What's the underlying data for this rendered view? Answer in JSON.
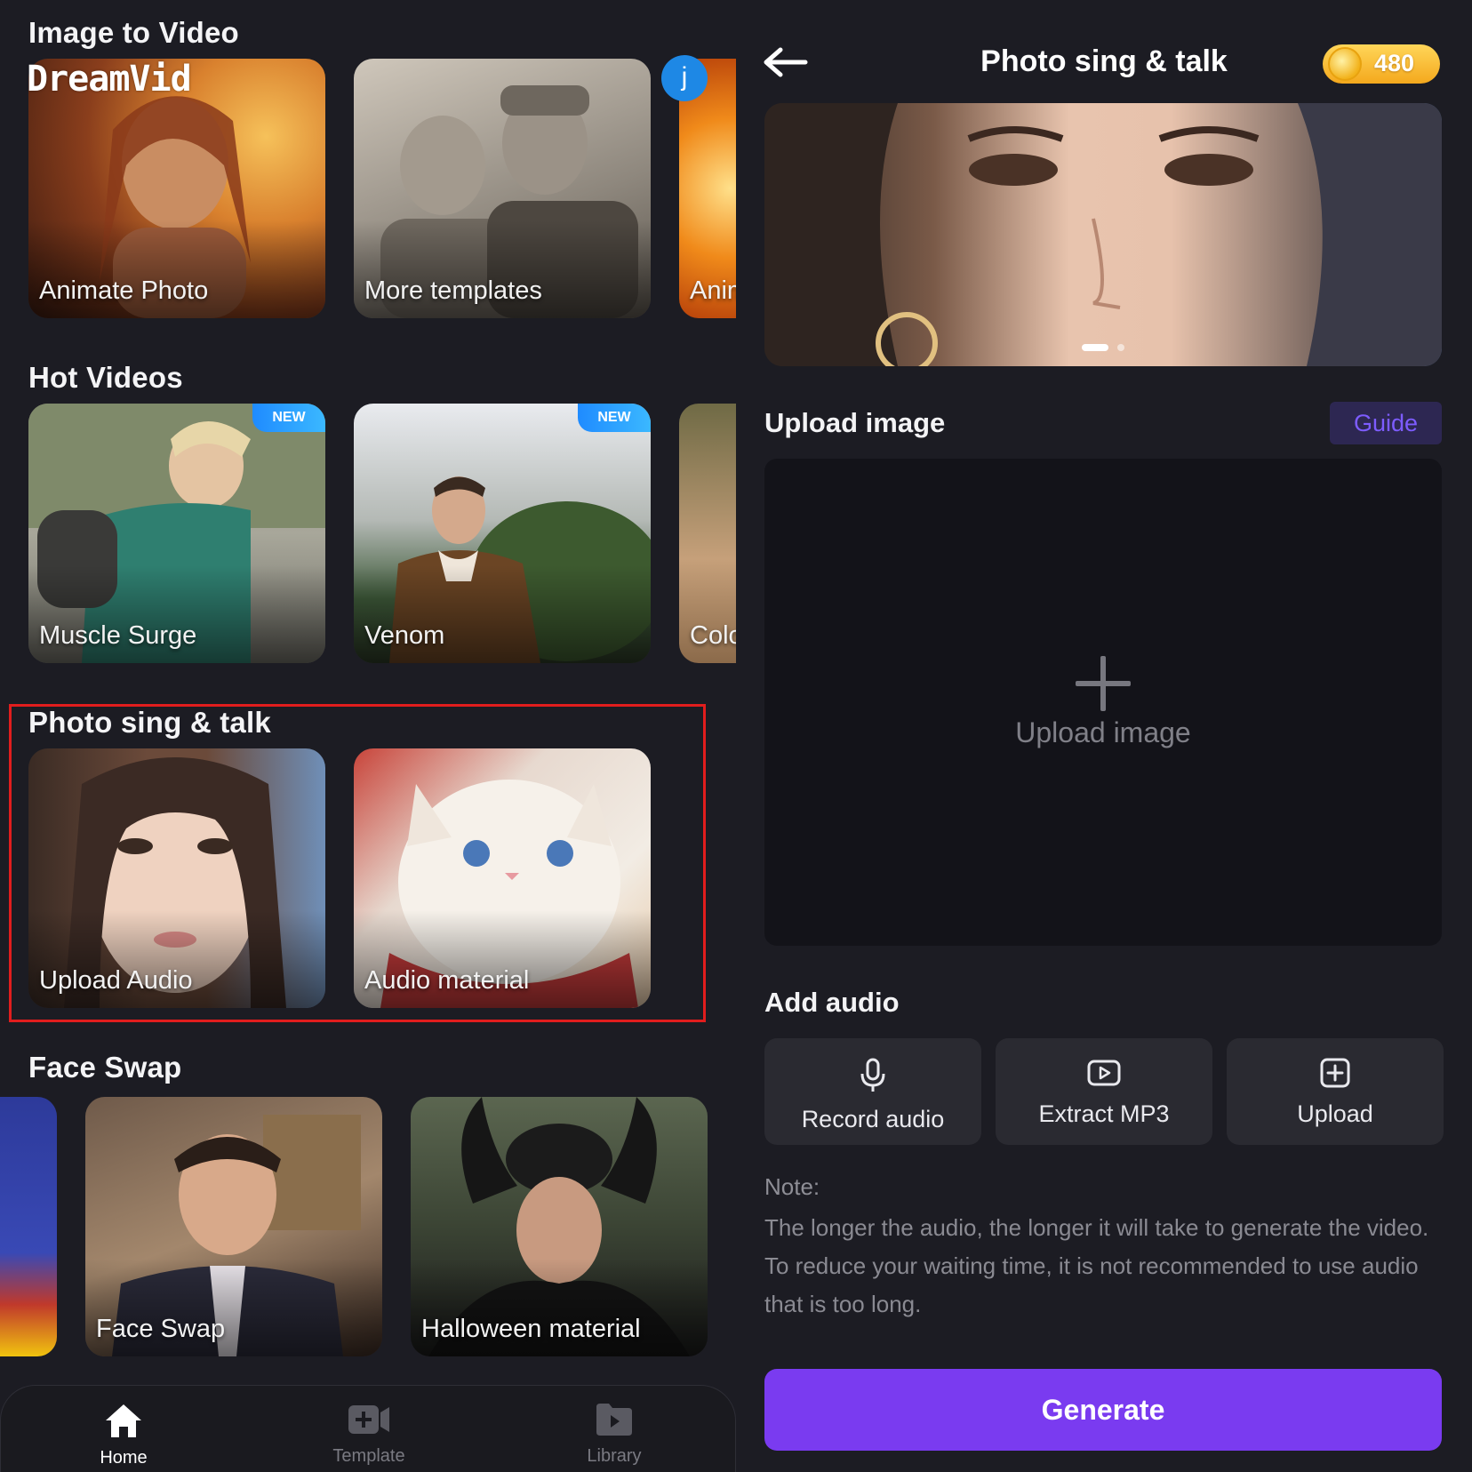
{
  "left": {
    "brand": "DreamVid",
    "avatar_letter": "j",
    "sections": {
      "image_to_video": {
        "title": "Image to Video",
        "cards": [
          "Animate Photo",
          "More templates",
          "Anim"
        ]
      },
      "hot_videos": {
        "title": "Hot Videos",
        "badge": "NEW",
        "cards": [
          "Muscle Surge",
          "Venom",
          "Colo"
        ]
      },
      "photo_sing_talk": {
        "title": "Photo sing & talk",
        "cards": [
          "Upload Audio",
          "Audio material"
        ]
      },
      "face_swap": {
        "title": "Face Swap",
        "cards": [
          "Face Swap",
          "Halloween material"
        ]
      }
    },
    "nav": [
      {
        "label": "Home",
        "icon": "home-icon",
        "active": true
      },
      {
        "label": "Template",
        "icon": "template-icon",
        "active": false
      },
      {
        "label": "Library",
        "icon": "library-icon",
        "active": false
      }
    ]
  },
  "right": {
    "title": "Photo sing & talk",
    "coins": "480",
    "upload_section_title": "Upload image",
    "guide_label": "Guide",
    "upload_area_label": "Upload image",
    "add_audio_title": "Add audio",
    "audio_buttons": [
      "Record audio",
      "Extract MP3",
      "Upload"
    ],
    "note_title": "Note:",
    "note_text": "The longer the audio, the longer it will take to generate the video. To reduce your waiting time, it is not recommended to use audio that is too long.",
    "generate_label": "Generate"
  },
  "colors": {
    "background": "#1c1c23",
    "accent_purple": "#7a3bf0",
    "guide_text": "#7d5cff",
    "highlight_border": "#e11d1d",
    "badge_blue": "#1f8bff",
    "coin_gold": "#f4a81d"
  }
}
